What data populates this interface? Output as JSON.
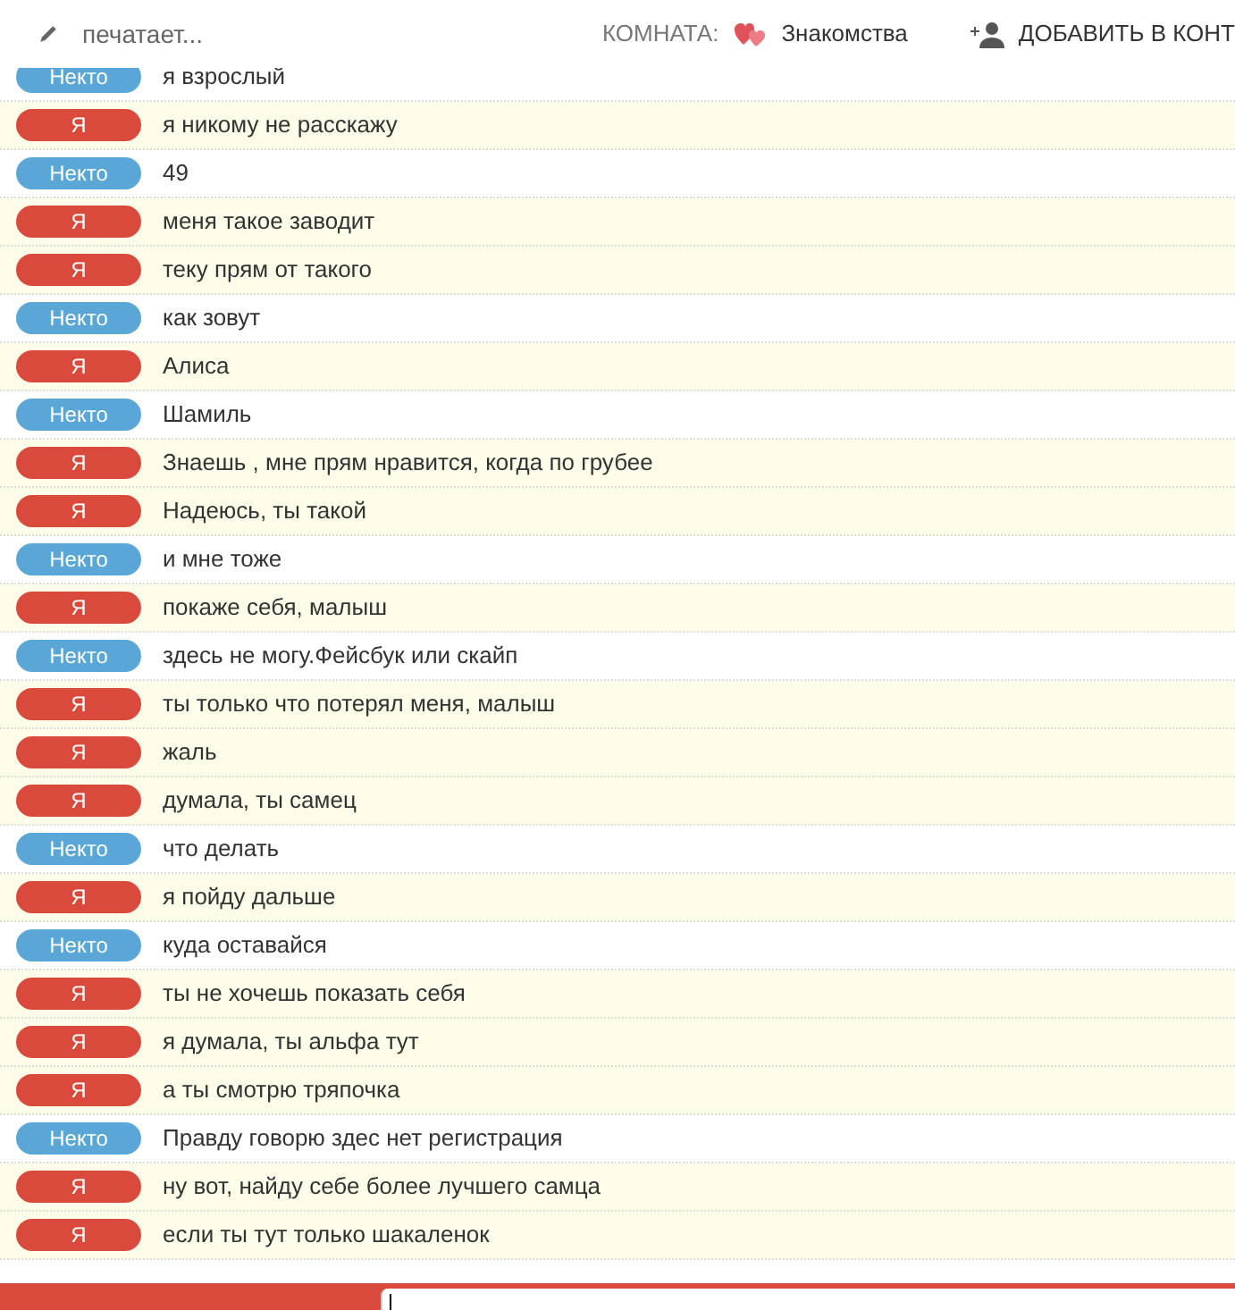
{
  "header": {
    "status": "печатает...",
    "room_label": "КОМНАТА:",
    "room_name": "Знакомства",
    "add_contact": "ДОБАВИТЬ В КОНТ"
  },
  "messages": [
    {
      "kind": "stranger",
      "sender": "Некто",
      "text": "я взрослый"
    },
    {
      "kind": "me",
      "sender": "Я",
      "text": "я никому не расскажу"
    },
    {
      "kind": "stranger",
      "sender": "Некто",
      "text": "49"
    },
    {
      "kind": "me",
      "sender": "Я",
      "text": "меня такое заводит"
    },
    {
      "kind": "me",
      "sender": "Я",
      "text": "теку прям от такого"
    },
    {
      "kind": "stranger",
      "sender": "Некто",
      "text": "как зовут"
    },
    {
      "kind": "me",
      "sender": "Я",
      "text": "Алиса"
    },
    {
      "kind": "stranger",
      "sender": "Некто",
      "text": "Шамиль"
    },
    {
      "kind": "me",
      "sender": "Я",
      "text": "Знаешь , мне прям нравится, когда по грубее"
    },
    {
      "kind": "me",
      "sender": "Я",
      "text": "Надеюсь, ты такой"
    },
    {
      "kind": "stranger",
      "sender": "Некто",
      "text": "и мне тоже"
    },
    {
      "kind": "me",
      "sender": "Я",
      "text": "покаже себя, малыш"
    },
    {
      "kind": "stranger",
      "sender": "Некто",
      "text": "здесь не могу.Фейсбук или скайп"
    },
    {
      "kind": "me",
      "sender": "Я",
      "text": "ты только что потерял меня, малыш"
    },
    {
      "kind": "me",
      "sender": "Я",
      "text": "жаль"
    },
    {
      "kind": "me",
      "sender": "Я",
      "text": "думала, ты самец"
    },
    {
      "kind": "stranger",
      "sender": "Некто",
      "text": "что делать"
    },
    {
      "kind": "me",
      "sender": "Я",
      "text": "я пойду дальше"
    },
    {
      "kind": "stranger",
      "sender": "Некто",
      "text": "куда оставайся"
    },
    {
      "kind": "me",
      "sender": "Я",
      "text": "ты не хочешь показать себя"
    },
    {
      "kind": "me",
      "sender": "Я",
      "text": "я думала, ты альфа тут"
    },
    {
      "kind": "me",
      "sender": "Я",
      "text": "а ты смотрю тряпочка"
    },
    {
      "kind": "stranger",
      "sender": "Некто",
      "text": "Правду говорю здес нет регистрация"
    },
    {
      "kind": "me",
      "sender": "Я",
      "text": "ну вот, найду себе более лучшего самца"
    },
    {
      "kind": "me",
      "sender": "Я",
      "text": "если ты тут только шакаленок"
    }
  ]
}
